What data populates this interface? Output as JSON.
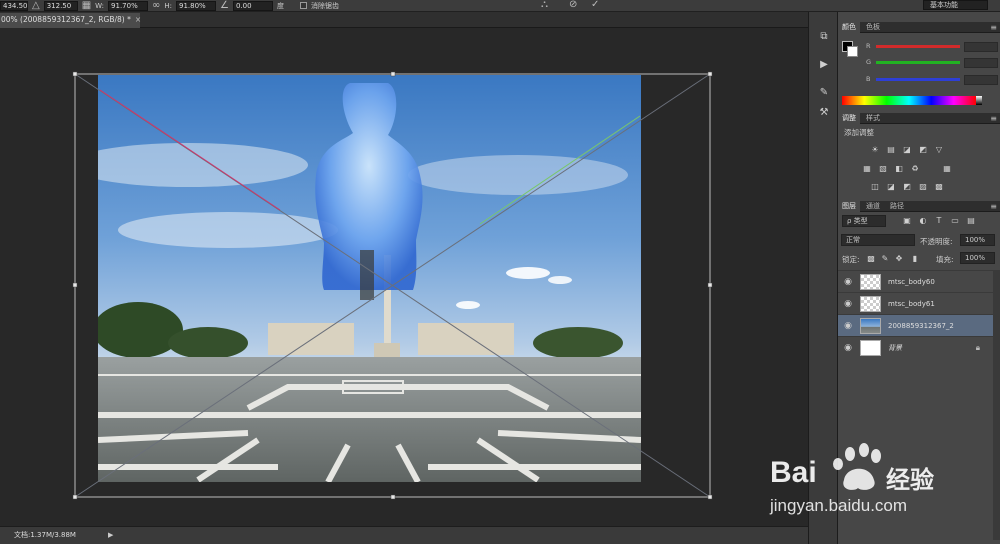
{
  "options_bar": {
    "x_value": "434.50 像",
    "y_value": "312.50 像",
    "w_label": "W:",
    "w_value": "91.70%",
    "h_label": "H:",
    "h_value": "91.80%",
    "angle_value": "0.00",
    "angle_unit": "度",
    "interp_label": "消除锯齿",
    "workspace": "基本功能"
  },
  "document_tab": {
    "title": "00% (2008859312367_2, RGB/8) *",
    "close": "×"
  },
  "status": {
    "doc_info": "文档:1.37M/3.88M",
    "arrow": "▶"
  },
  "color_panel": {
    "tabs": [
      "颜色",
      "色板"
    ],
    "channels": [
      "R",
      "G",
      "B"
    ],
    "channel_colors": [
      "#d22b2b",
      "#22b322",
      "#2e3fd6"
    ]
  },
  "adjust_panel": {
    "tabs": [
      "调整",
      "样式"
    ],
    "add_label": "添加调整",
    "row1_icons": [
      "☀",
      "▤",
      "◪",
      "◩",
      "▽"
    ],
    "row2_icons": [
      "▦",
      "▧",
      "◧",
      "♻",
      "▦"
    ],
    "row3_icons": [
      "◫",
      "◪",
      "◩",
      "▨",
      "▩"
    ]
  },
  "layers_panel": {
    "tabs": [
      "图层",
      "通道",
      "路径"
    ],
    "kind_label": "ρ 类型",
    "blend_mode": "正常",
    "opacity_label": "不透明度:",
    "opacity_value": "100%",
    "lock_label": "锁定:",
    "fill_label": "填充:",
    "fill_value": "100%",
    "layers": [
      {
        "name": "mtsc_body60",
        "selected": false
      },
      {
        "name": "mtsc_body61",
        "selected": false
      },
      {
        "name": "2008859312367_2",
        "selected": true
      },
      {
        "name": "背景",
        "selected": false
      }
    ]
  },
  "watermark": {
    "brand": "Bai",
    "brand_end": "经验",
    "url": "jingyan.baidu.com"
  }
}
